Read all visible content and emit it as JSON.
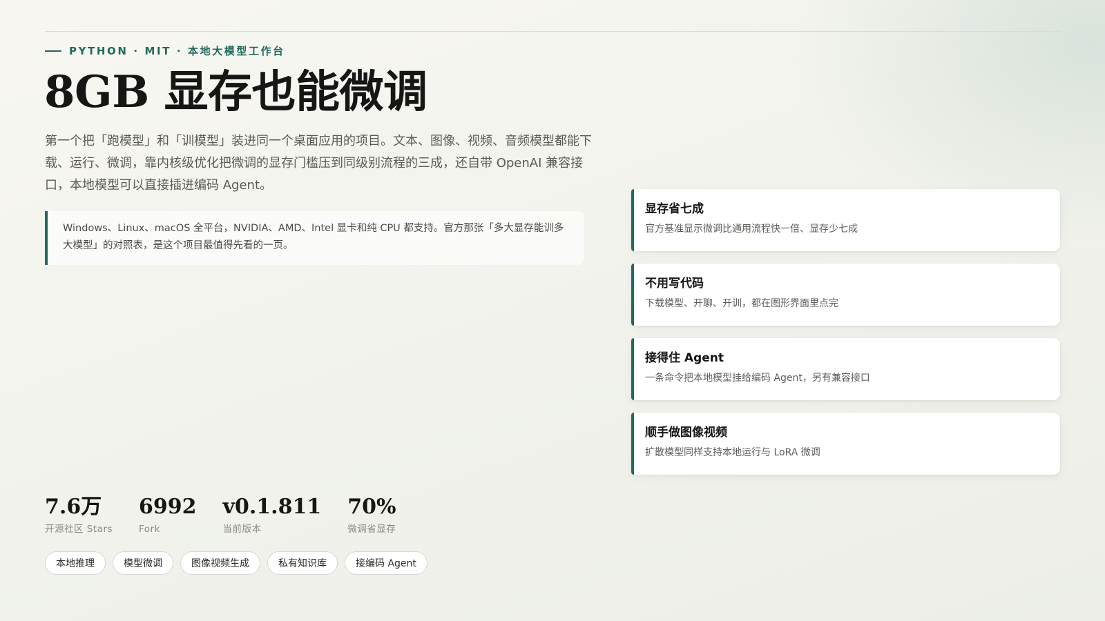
{
  "header": {
    "eyebrow": "PYTHON · MIT · 本地大模型工作台",
    "title": "8GB 显存也能微调",
    "lead": "第一个把「跑模型」和「训模型」装进同一个桌面应用的项目。文本、图像、视频、音频模型都能下载、运行、微调，靠内核级优化把微调的显存门槛压到同级别流程的三成，还自带 OpenAI 兼容接口，本地模型可以直接插进编码 Agent。",
    "callout": "Windows、Linux、macOS 全平台，NVIDIA、AMD、Intel 显卡和纯 CPU 都支持。官方那张「多大显存能训多大模型」的对照表，是这个项目最值得先看的一页。"
  },
  "features": [
    {
      "title": "显存省七成",
      "desc": "官方基准显示微调比通用流程快一倍、显存少七成"
    },
    {
      "title": "不用写代码",
      "desc": "下载模型、开聊、开训，都在图形界面里点完"
    },
    {
      "title": "接得住 Agent",
      "desc": "一条命令把本地模型挂给编码 Agent，另有兼容接口"
    },
    {
      "title": "顺手做图像视频",
      "desc": "扩散模型同样支持本地运行与 LoRA 微调"
    }
  ],
  "stats": [
    {
      "value": "7.6万",
      "label": "开源社区 Stars"
    },
    {
      "value": "6992",
      "label": "Fork"
    },
    {
      "value": "v0.1.811",
      "label": "当前版本"
    },
    {
      "value": "70%",
      "label": "微调省显存"
    }
  ],
  "tags": [
    "本地推理",
    "模型微调",
    "图像视频生成",
    "私有知识库",
    "接编码 Agent"
  ],
  "colors": {
    "accent": "#23695f",
    "heading": "#161614",
    "body_text": "#5a5a56",
    "background": "#f3f3ee"
  }
}
